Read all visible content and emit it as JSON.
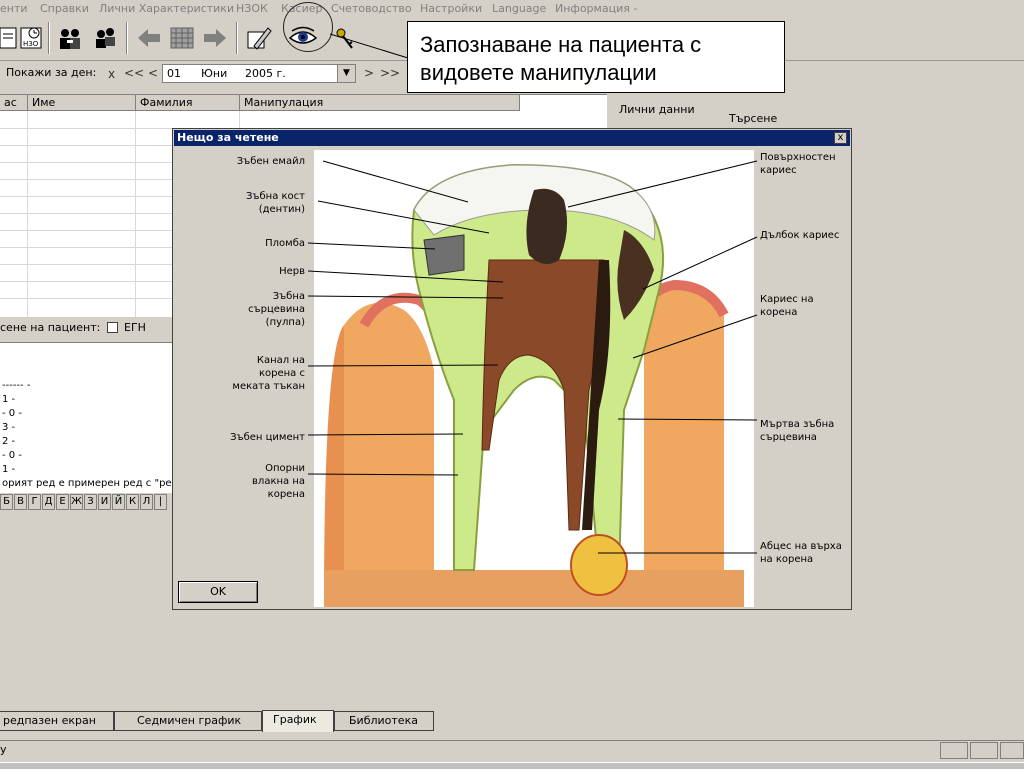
{
  "menu": {
    "items": [
      "енти",
      "Справки",
      "Лични Характеристики",
      "НЗОК",
      "Касиер",
      "Счетоводство",
      "Настройки",
      "Language",
      "Информация -"
    ]
  },
  "toolbar": {
    "icons": [
      "new-document-icon",
      "calendar-icon",
      "patients-icon",
      "patients-edit-icon",
      "back-arrow-icon",
      "grid-icon",
      "forward-arrow-icon",
      "edit-pen-icon",
      "eye-icon",
      "key-icon"
    ]
  },
  "callout": {
    "text": "Запознаване на пациента с видовете манипулации"
  },
  "date_row": {
    "label": "Покажи за ден:",
    "clear": "x",
    "prev_fast": "<<",
    "prev": "<",
    "day": "01",
    "month": "Юни",
    "year": "2005 г.",
    "dropdown": "▼",
    "next": ">",
    "next_fast": ">>"
  },
  "grid": {
    "columns": [
      "ас",
      "Име",
      "Фамилия",
      "Манипулация"
    ]
  },
  "right_pane": {
    "personal": "Лични данни",
    "search": "Търсене"
  },
  "search_row": {
    "label": "сене на пациент:",
    "checkbox_label": "ЕГН"
  },
  "lower_list": {
    "lines": [
      "------  -",
      "1  -",
      "- 0  -",
      "3  -",
      "2  -",
      "- 0  -",
      "1  -",
      "орият ред е примерен ред с \"ре"
    ]
  },
  "alphabet": [
    "Б",
    "В",
    "Г",
    "Д",
    "Е",
    "Ж",
    "З",
    "И",
    "Й",
    "К",
    "Л",
    "|"
  ],
  "dialog": {
    "title": "Нещо за четене",
    "close": "x",
    "ok": "OK",
    "labels_left": [
      "Зъбен емайл",
      "Зъбна кост\n(дентин)",
      "Пломба",
      "Нерв",
      "Зъбна\nсърцевина\n(пулпа)",
      "Канал на\nкорена с\nмеката тъкан",
      "Зъбен цимент",
      "Опорни\nвлакна на\nкорена"
    ],
    "labels_right": [
      "Повърхностен\nкариес",
      "Дълбок кариес",
      "Кариес на\nкорена",
      "Мъртва зъбна\nсърцевина",
      "Абцес на върха\nна корена"
    ]
  },
  "tabs": [
    "редпазен екран",
    "Седмичен график",
    "График",
    "Библиотека"
  ],
  "active_tab": "График",
  "status": {
    "text": "y"
  }
}
